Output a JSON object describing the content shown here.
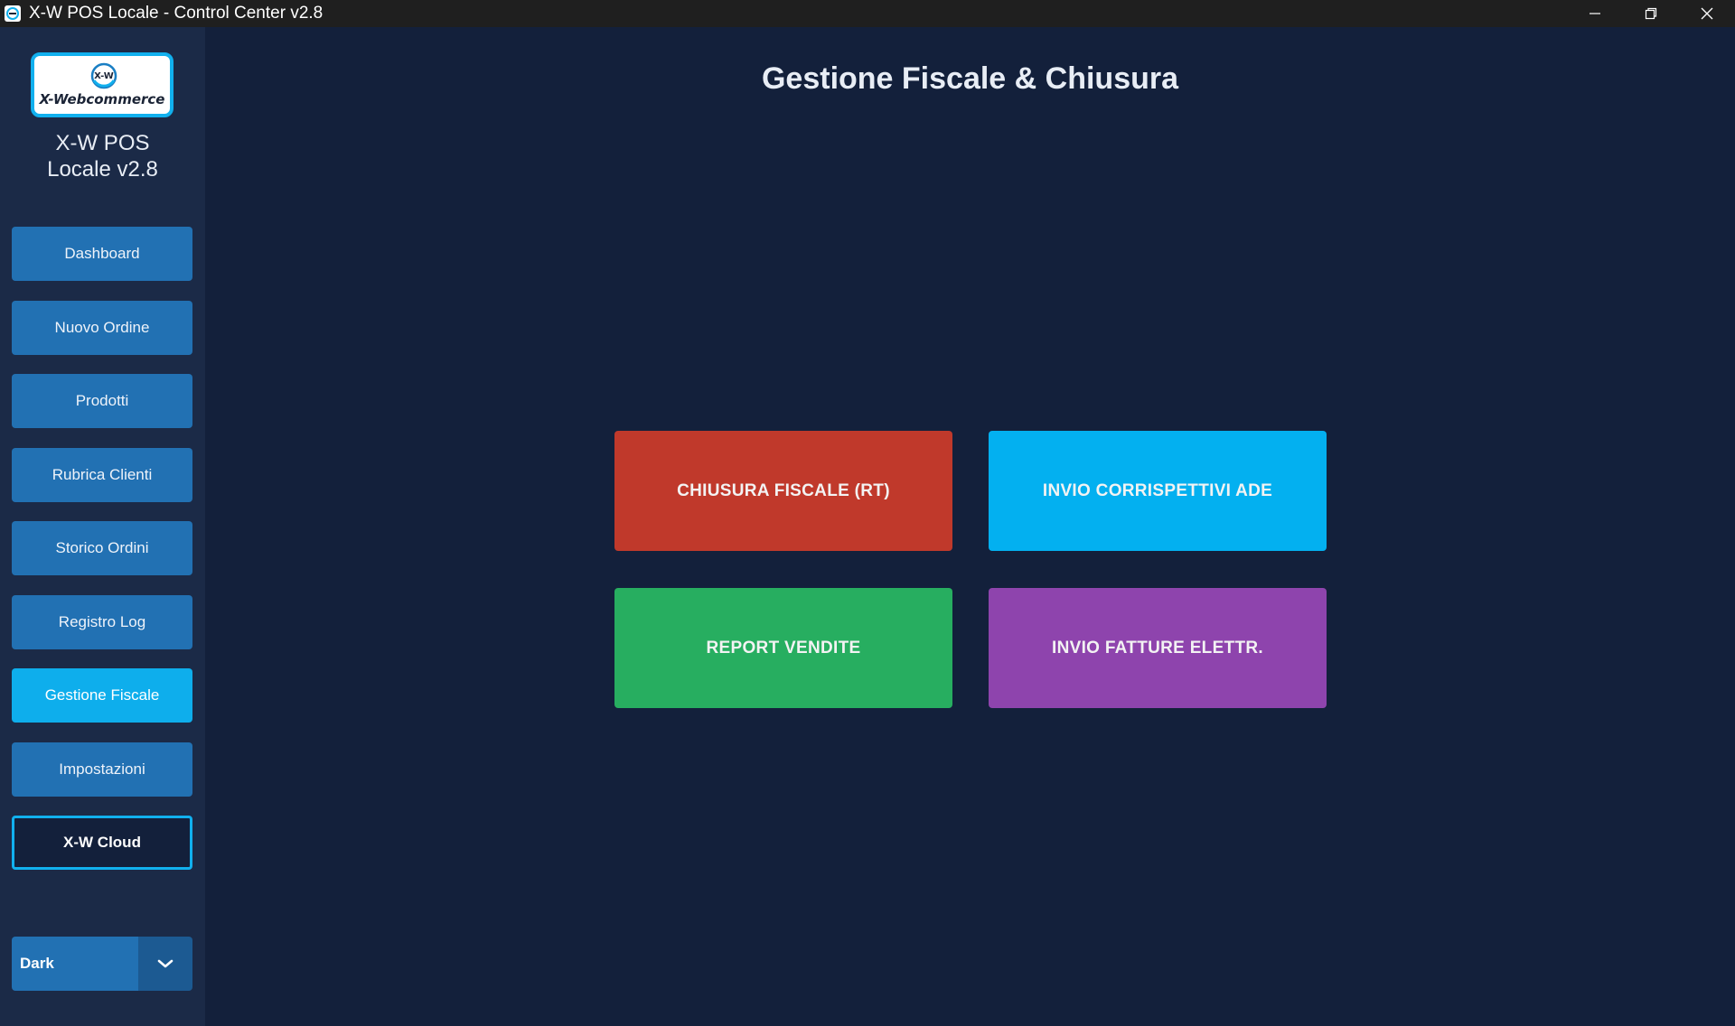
{
  "window": {
    "title": "X-W POS Locale - Control Center v2.8",
    "icons": [
      "app-icon",
      "minimize-icon",
      "restore-icon",
      "close-icon"
    ]
  },
  "sidebar": {
    "logo": {
      "mark_text": "X-W",
      "text": "X-Webcommerce"
    },
    "app_name": "X-W POS\nLocale v2.8",
    "items": [
      {
        "label": "Dashboard"
      },
      {
        "label": "Nuovo Ordine"
      },
      {
        "label": "Prodotti"
      },
      {
        "label": "Rubrica Clienti"
      },
      {
        "label": "Storico Ordini"
      },
      {
        "label": "Registro Log"
      },
      {
        "label": "Gestione Fiscale"
      },
      {
        "label": "Impostazioni"
      },
      {
        "label": "X-W Cloud"
      }
    ],
    "theme_select": {
      "value": "Dark",
      "icon": "chevron-down-icon"
    }
  },
  "main": {
    "title": "Gestione Fiscale & Chiusura",
    "actions": [
      {
        "label": "CHIUSURA FISCALE (RT)",
        "color": "#c0392b"
      },
      {
        "label": "INVIO CORRISPETTIVI ADE",
        "color": "#03b0f0"
      },
      {
        "label": "REPORT VENDITE",
        "color": "#27ae60"
      },
      {
        "label": "INVIO FATTURE ELETTR.",
        "color": "#8e44ad"
      }
    ]
  },
  "colors": {
    "background": "#13203b",
    "sidebar": "#1b2a47",
    "nav_button": "#2271b3",
    "nav_active": "#0eaeec",
    "accent": "#11b0ee"
  }
}
